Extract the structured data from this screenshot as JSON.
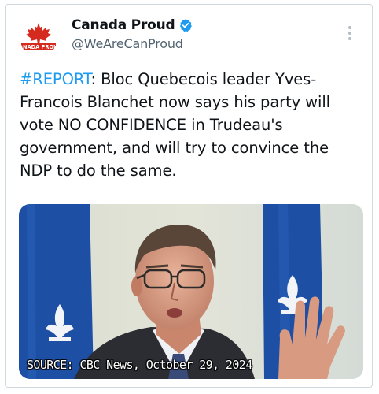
{
  "account": {
    "display_name": "Canada Proud",
    "handle": "@WeAreCanProud",
    "verified": true,
    "avatar_text": "CANADA PROUD"
  },
  "tweet": {
    "hashtag": "#REPORT",
    "body": ": Bloc Quebecois leader Yves-Francois Blanchet now says his party will vote NO CONFIDENCE in Trudeau's government, and will try to convince the NDP to do the same."
  },
  "media": {
    "caption": "SOURCE: CBC News, October 29, 2024"
  },
  "colors": {
    "verified_badge": "#1d9bf0",
    "hashtag": "#1d9bf0",
    "maple_leaf": "#d52b1e",
    "quebec_flag_blue": "#1d4fa5"
  }
}
